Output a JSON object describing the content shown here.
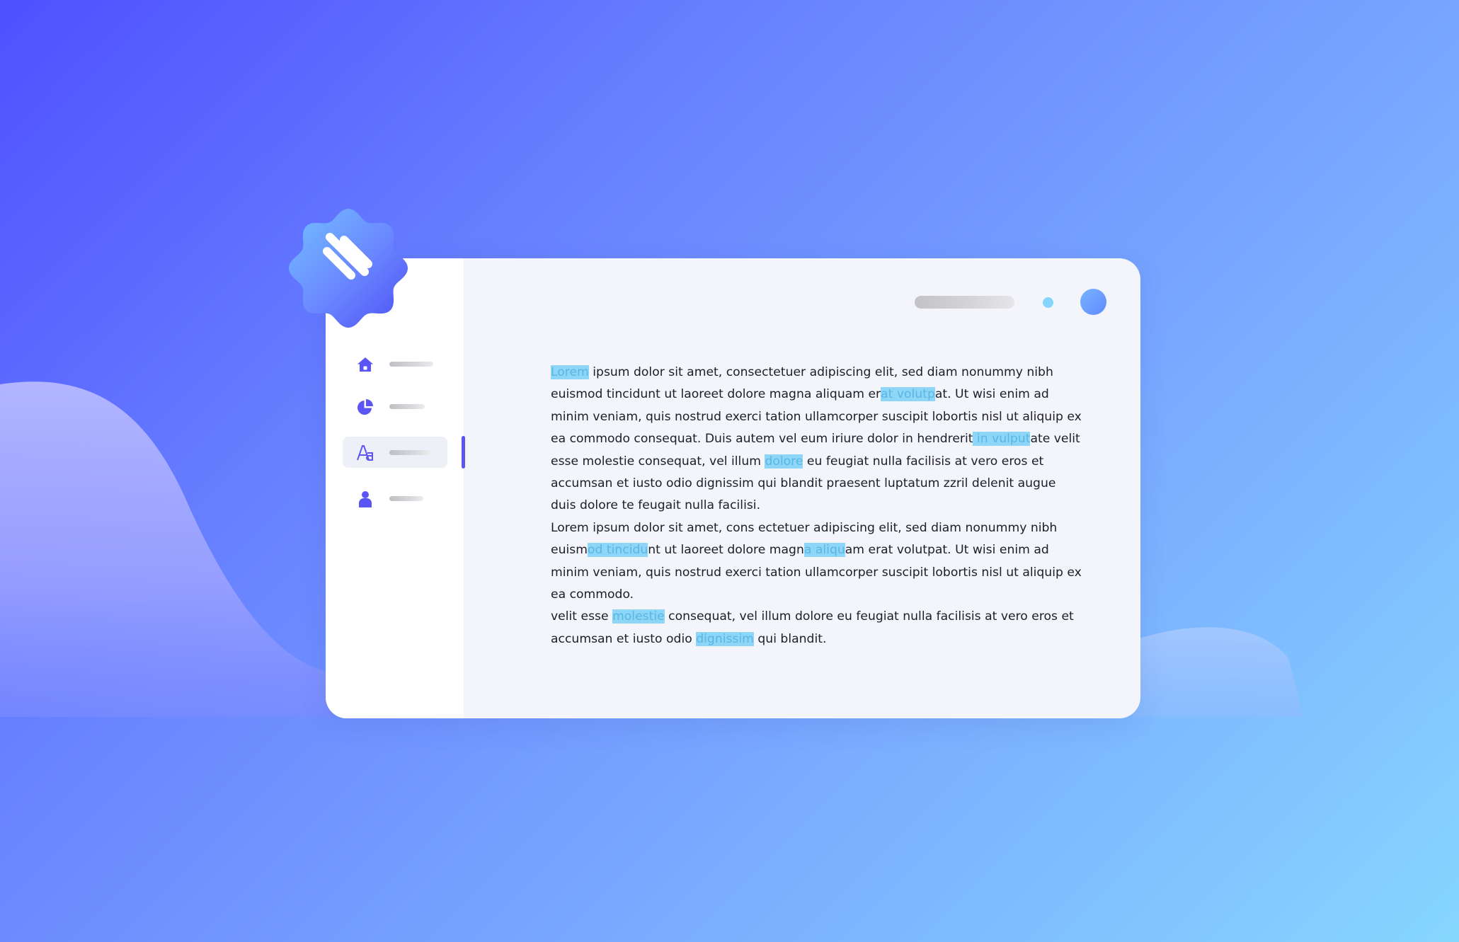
{
  "colors": {
    "accent": "#5b55f3",
    "highlight": "#8ed6f7",
    "highlight_text": "#5ab6e2",
    "status_dot": "#84d4fb",
    "avatar": "#6a9bff"
  },
  "badge": {
    "icon": "three-stripes-gear-icon"
  },
  "header": {
    "search_placeholder": "",
    "status_icon": "status-dot-icon",
    "avatar_icon": "avatar-icon"
  },
  "sidebar": {
    "items": [
      {
        "icon": "home-icon",
        "label": "",
        "active": false
      },
      {
        "icon": "pie-chart-icon",
        "label": "",
        "active": false
      },
      {
        "icon": "font-icon",
        "label": "",
        "active": true
      },
      {
        "icon": "user-icon",
        "label": "",
        "active": false
      }
    ]
  },
  "document": {
    "lines": [
      [
        {
          "t": "Lorem",
          "hl": true
        },
        {
          "t": " ipsum dolor sit amet, consectetuer adipiscing elit, sed diam nonummy nibh"
        }
      ],
      [
        {
          "t": "euismod tincidunt ut laoreet dolore magna aliquam er"
        },
        {
          "t": "at volutp",
          "hl": true
        },
        {
          "t": "at. Ut wisi enim ad"
        }
      ],
      [
        {
          "t": "minim veniam, quis nostrud exerci tation ullamcorper suscipit lobortis nisl ut aliquip ex"
        }
      ],
      [
        {
          "t": "ea commodo consequat. Duis autem vel eum iriure dolor in hendrerit"
        },
        {
          "t": " in vulput",
          "hl": true
        },
        {
          "t": "ate velit"
        }
      ],
      [
        {
          "t": "esse molestie consequat, vel illum "
        },
        {
          "t": "dolore",
          "hl": true
        },
        {
          "t": " eu feugiat nulla facilisis at vero eros et"
        }
      ],
      [
        {
          "t": "accumsan et iusto odio dignissim qui blandit praesent luptatum zzril delenit augue"
        }
      ],
      [
        {
          "t": "duis dolore te feugait nulla facilisi."
        }
      ],
      [
        {
          "t": "Lorem ipsum dolor sit amet, cons ectetuer adipiscing elit, sed diam nonummy nibh"
        }
      ],
      [
        {
          "t": "euism"
        },
        {
          "t": "od tincidu",
          "hl": true
        },
        {
          "t": "nt ut laoreet dolore magn"
        },
        {
          "t": "a aliqu",
          "hl": true
        },
        {
          "t": "am erat volutpat. Ut wisi enim ad"
        }
      ],
      [
        {
          "t": "minim veniam, quis nostrud exerci tation ullamcorper suscipit lobortis nisl ut aliquip ex"
        }
      ],
      [
        {
          "t": "ea commodo."
        }
      ],
      [
        {
          "t": "velit esse "
        },
        {
          "t": "molestie",
          "hl": true
        },
        {
          "t": " consequat, vel illum dolore eu feugiat nulla facilisis at vero eros et"
        }
      ],
      [
        {
          "t": "accumsan et iusto odio "
        },
        {
          "t": "dignissim",
          "hl": true
        },
        {
          "t": " qui blandit."
        }
      ]
    ]
  }
}
